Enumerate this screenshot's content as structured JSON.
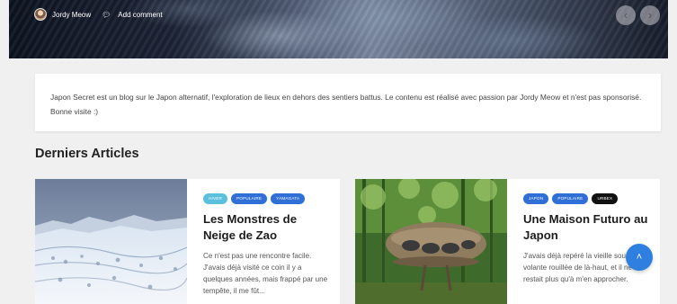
{
  "hero": {
    "author": "Jordy Meow",
    "comment_label": "Add comment",
    "prev_icon": "chevron-left",
    "next_icon": "chevron-right"
  },
  "intro": {
    "text": "Japon Secret est un blog sur le Japon alternatif, l'exploration de lieux en dehors des sentiers battus. Le contenu est réalisé avec passion par Jordy Meow et n'est pas sponsorisé. Bonne visite :)"
  },
  "section_title": "Derniers Articles",
  "articles": [
    {
      "tags": [
        {
          "label": "HIVER",
          "color": "#5bc0de"
        },
        {
          "label": "POPULAIRE",
          "color": "#2f6fd6"
        },
        {
          "label": "YAMAGATA",
          "color": "#2f6fd6"
        }
      ],
      "title": "Les Monstres de Neige de Zao",
      "excerpt": "Ce n'est pas une rencontre facile. J'avais déjà visité ce coin il y a quelques années, mais frappé par une tempête, il me fût..."
    },
    {
      "tags": [
        {
          "label": "JAPON",
          "color": "#2f6fd6"
        },
        {
          "label": "POPULAIRE",
          "color": "#2f6fd6"
        },
        {
          "label": "URBEX",
          "color": "#111111"
        }
      ],
      "title": "Une Maison Futuro au Japon",
      "excerpt": "J'avais déjà repéré la vieille soucoupe volante rouillée de là-haut, et il ne me restait plus qu'à m'en approcher."
    }
  ],
  "scroll_top_icon": "chevron-up"
}
